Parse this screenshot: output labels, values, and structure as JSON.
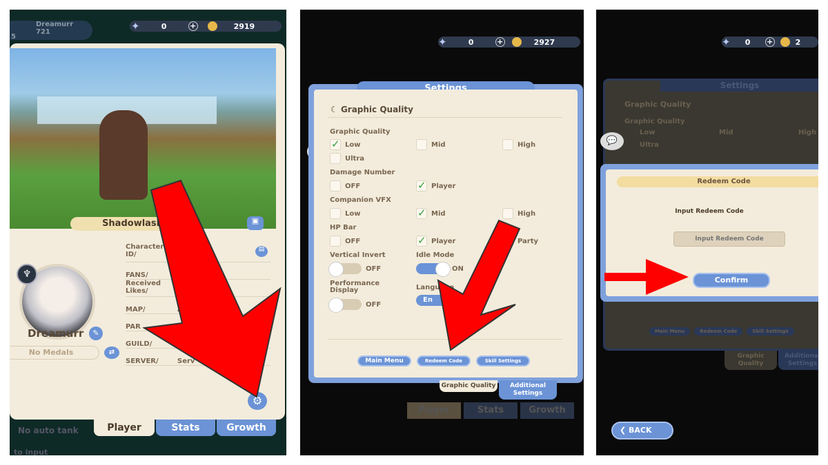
{
  "panel1": {
    "player_badge": {
      "name": "Dreamurr",
      "power": "721",
      "level": "5"
    },
    "currency": {
      "stars": "0",
      "coins": "2919"
    },
    "character_banner": "Shadowlash",
    "player_name": "Dreamurr",
    "medals": "No Medals",
    "info_rows": [
      {
        "label": "Character ID/",
        "value": ""
      },
      {
        "label": "FANS/",
        "value": ""
      },
      {
        "label": "Received Likes/",
        "value": ""
      },
      {
        "label": "MAP/",
        "value": "Ad"
      },
      {
        "label": "PAR",
        "value": ""
      },
      {
        "label": "GUILD/",
        "value": ""
      },
      {
        "label": "SERVER/",
        "value": "Serv"
      }
    ],
    "tabs": [
      "Player",
      "Stats",
      "Growth"
    ],
    "behind_text": [
      "No auto tank",
      "to input"
    ]
  },
  "panel2": {
    "currency": {
      "stars": "0",
      "coins": "2927"
    },
    "dialog_title": "Settings",
    "section": "Graphic Quality",
    "groups": {
      "graphic_quality": {
        "label": "Graphic Quality",
        "options": [
          "Low",
          "Mid",
          "High",
          "Ultra"
        ],
        "selected": "Low"
      },
      "damage_number": {
        "label": "Damage Number",
        "options": [
          "OFF",
          "Player"
        ],
        "selected": "Player"
      },
      "companion_vfx": {
        "label": "Companion VFX",
        "options": [
          "Low",
          "Mid",
          "High"
        ],
        "selected": "Mid"
      },
      "hp_bar": {
        "label": "HP Bar",
        "options": [
          "OFF",
          "Player",
          "Party"
        ],
        "selected": "Player"
      },
      "vertical_invert": {
        "label": "Vertical Invert",
        "state": "OFF"
      },
      "idle_mode": {
        "label": "Idle Mode",
        "state": "ON"
      },
      "performance_display": {
        "label": "Performance Display",
        "state": "OFF"
      },
      "language": {
        "label": "Language",
        "value": "En"
      }
    },
    "buttons": [
      "Main Menu",
      "Redeem Code",
      "Skill Settings"
    ],
    "tabs": [
      "Graphic Quality",
      "Additional Settings"
    ],
    "behind_tabs": [
      "Player",
      "Stats",
      "Growth"
    ]
  },
  "panel3": {
    "currency": {
      "stars": "0",
      "coins": "2"
    },
    "behind_title": "Settings",
    "behind_section": "Graphic Quality",
    "behind_options": [
      "Graphic Quality",
      "Low",
      "Mid",
      "High",
      "Ultra"
    ],
    "behind_buttons": [
      "Main Menu",
      "Redeem Code",
      "Skill Settings"
    ],
    "behind_tabs": [
      "Graphic Quality",
      "Additional Settings"
    ],
    "dialog_title": "Redeem Code",
    "prompt": "Input Redeem Code",
    "input_placeholder": "Input Redeem Code",
    "confirm": "Confirm",
    "back": "BACK"
  },
  "colors": {
    "arrow": "#ff0000",
    "accent_blue": "#6b93d6",
    "parchment": "#f3ecdc"
  }
}
